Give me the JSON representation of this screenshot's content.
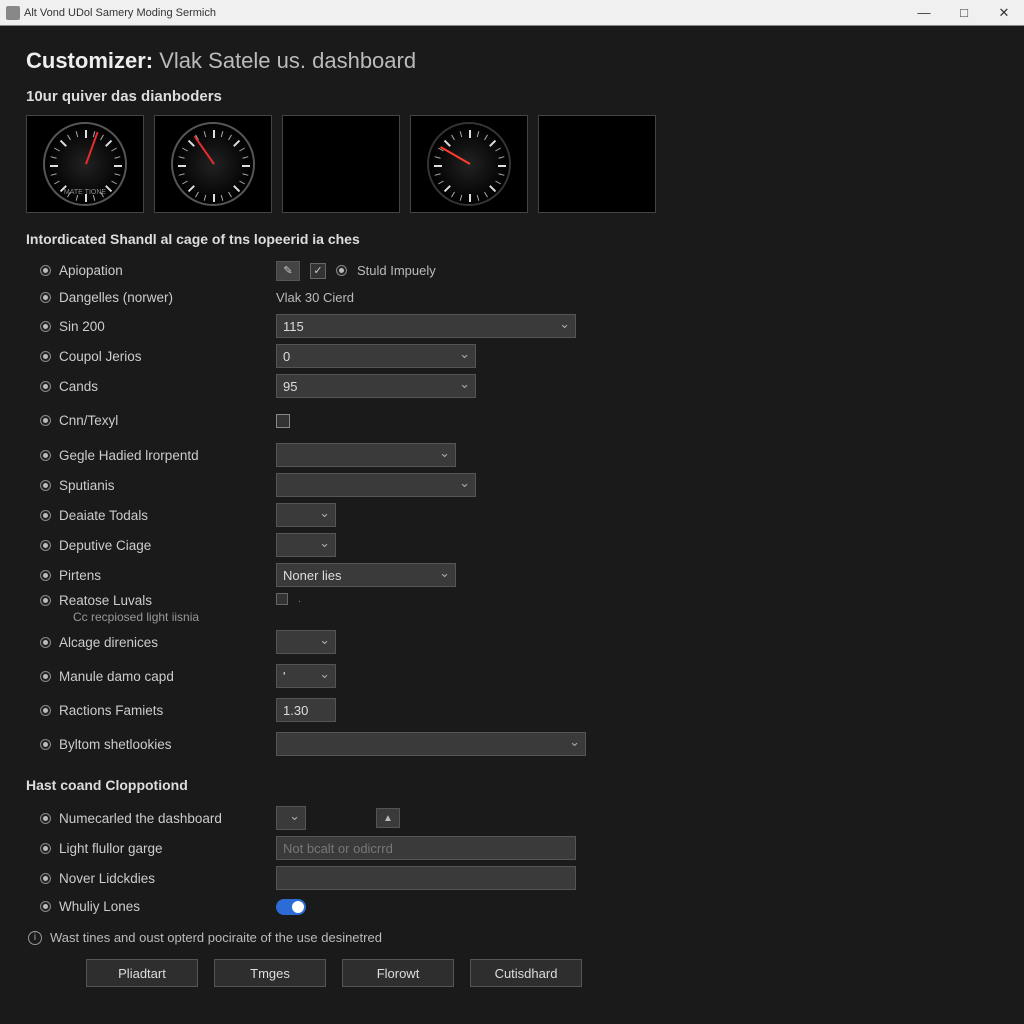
{
  "window": {
    "title": "Alt Vond UDol Samery Moding Sermich"
  },
  "header": {
    "prefix": "Customizer:",
    "title": "Vlak Satele us. dashboard"
  },
  "gauges_section": {
    "title": "10ur quiver das dianboders"
  },
  "config_section": {
    "title": "Intordicated Shandl al cage of tns lopeerid ia ches"
  },
  "rows": {
    "apiopation": {
      "label": "Apiopation",
      "chk_label": "Stuld Impuely"
    },
    "dangelles": {
      "label": "Dangelles (norwer)",
      "value": "Vlak 30 Cierd"
    },
    "sin": {
      "label": "Sin 200",
      "value": "115"
    },
    "coupol": {
      "label": "Coupol Jerios",
      "value": "0"
    },
    "cands": {
      "label": "Cands",
      "value": "95"
    },
    "cnntexyl": {
      "label": "Cnn/Texyl"
    },
    "gegle": {
      "label": "Gegle Hadied lrorpentd",
      "value": ""
    },
    "sputianis": {
      "label": "Sputianis",
      "value": ""
    },
    "deaiate": {
      "label": "Deaiate Todals",
      "value": ""
    },
    "deputive": {
      "label": "Deputive Ciage",
      "value": ""
    },
    "pirtens": {
      "label": "Pirtens",
      "value": "Noner lies"
    },
    "reatose": {
      "label": "Reatose Luvals",
      "sublabel": "Cc recpiosed light iisnia"
    },
    "alcage": {
      "label": "Alcage direnices",
      "value": ""
    },
    "manule": {
      "label": "Manule damo capd",
      "value": "'"
    },
    "ractions": {
      "label": "Ractions Famiets",
      "value": "1.30"
    },
    "byltom": {
      "label": "Byltom shetlookies",
      "value": ""
    }
  },
  "hast_section": {
    "title": "Hast coand Cloppotiond",
    "numecarled": {
      "label": "Numecarled the dashboard"
    },
    "light_fullor": {
      "label": "Light flullor garge",
      "placeholder": "Not bcalt or odicrrd"
    },
    "nover": {
      "label": "Nover Lidckdies",
      "value": ""
    },
    "whuliy": {
      "label": "Whuliy Lones"
    }
  },
  "info_text": "Wast tines and oust opterd pociraite of the use desinetred",
  "buttons": {
    "pliadtart": "Pliadtart",
    "tmges": "Tmges",
    "florowt": "Florowt",
    "cutisdhard": "Cutisdhard"
  }
}
